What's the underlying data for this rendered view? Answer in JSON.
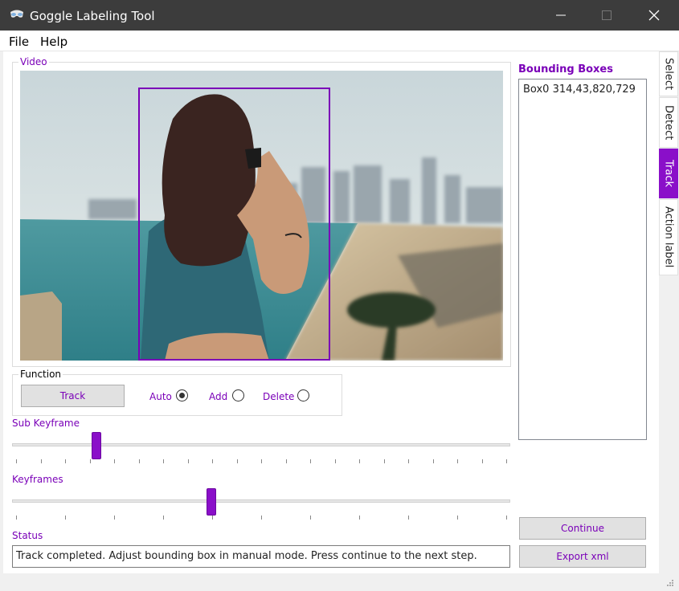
{
  "window": {
    "title": "Goggle Labeling Tool",
    "controls": [
      "minimize-icon",
      "maximize-icon",
      "close-icon"
    ]
  },
  "menu": {
    "file": "File",
    "help": "Help"
  },
  "video": {
    "group_title": "Video"
  },
  "function": {
    "group_title": "Function",
    "track_button": "Track",
    "radios": [
      {
        "label": "Auto",
        "checked": true
      },
      {
        "label": "Add",
        "checked": false
      },
      {
        "label": "Delete",
        "checked": false
      }
    ]
  },
  "sliders": {
    "sub_keyframe": {
      "label": "Sub Keyframe",
      "value_fraction": 0.17
    },
    "keyframes": {
      "label": "Keyframes",
      "value_fraction": 0.4
    }
  },
  "status": {
    "label": "Status",
    "text": "Track completed. Adjust bounding box in manual mode. Press continue to the next step."
  },
  "bounding_boxes": {
    "title": "Bounding Boxes",
    "items": [
      "Box0 314,43,820,729"
    ]
  },
  "buttons": {
    "continue": "Continue",
    "export": "Export xml"
  },
  "tabs": [
    {
      "label": "Select",
      "active": false
    },
    {
      "label": "Detect",
      "active": false
    },
    {
      "label": "Track",
      "active": true
    },
    {
      "label": "Action label",
      "active": false
    }
  ],
  "colors": {
    "accent": "#8a0fc9",
    "titlebar": "#3c3c3c"
  }
}
